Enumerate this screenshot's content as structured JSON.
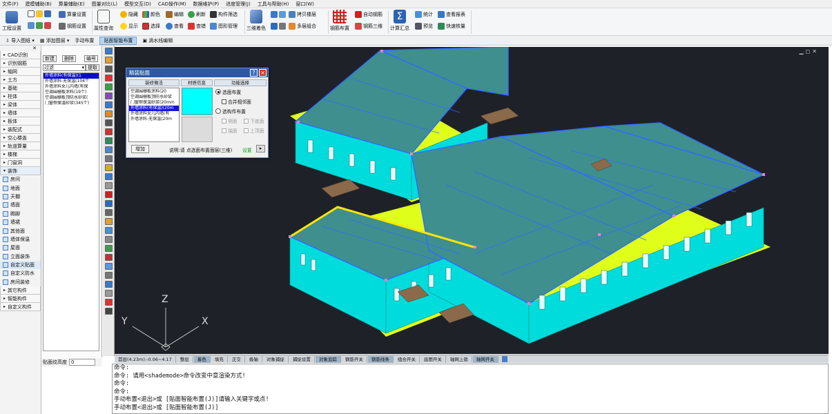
{
  "menu": [
    "文件(F)",
    "建模辅助(B)",
    "算量辅助(E)",
    "图量对比(L)",
    "模型交互(D)",
    "CAD操作(M)",
    "数据维护(P)",
    "进度管理(J)",
    "工具与帮助(H)",
    "窗口(W)"
  ],
  "ribbon": {
    "project_settings": "工程设置",
    "calc_settings": "算量设置",
    "rebar_settings": "钢筋设置",
    "property_query": "属性查询",
    "hide": "隐藏",
    "show": "显示",
    "color": "颜色",
    "select": "选择",
    "edit": "编辑",
    "view": "查看",
    "refresh": "刷新",
    "check": "查错",
    "component_filter": "构件筛选",
    "graphic_manage": "图形管理",
    "color3d": "三维着色",
    "copy_floor": "拷贝楼层",
    "multi_combine": "多层组合",
    "rebar_layout": "钢筋布置",
    "auto_rebar": "自动钢筋",
    "rebar3d": "钢筋三维",
    "calc_summary": "计算汇总",
    "stats": "统计",
    "preview": "预览",
    "view_report": "查看报表",
    "quick_check": "快速核量"
  },
  "subbar": {
    "import_drawing": "导入图纸",
    "add_layer": "添加图层",
    "manual_layout": "手动布置",
    "smart_layout": "贴面智能布置",
    "drip_edit": "滴水线编辑"
  },
  "categories_top": [
    "CAD识别",
    "识别钢筋",
    "轴网",
    "土方",
    "基础",
    "柱体",
    "梁体",
    "墙体",
    "板体",
    "装配式",
    "空心楼盖",
    "轨道算量",
    "楼梯",
    "门窗洞",
    "装饰"
  ],
  "decor_items": [
    "房间",
    "地面",
    "天棚",
    "墙面",
    "踢脚",
    "墙裙",
    "其他面",
    "墙体保温",
    "屋面",
    "立面装饰",
    "自定义贴面",
    "自定义防水",
    "房间装修"
  ],
  "categories_bottom": [
    "其它构件",
    "智能构件",
    "自定义构件"
  ],
  "list_panel": {
    "new_btn": "新建",
    "delete_btn": "删除",
    "copy_btn": "编号",
    "filter_label": "过滤",
    "extract_btn": "提取",
    "items": [
      "外墙涂料(有保温)(1",
      "外墙涂料-无保温(104个",
      "外墙涂料女儿内墙(有保",
      "空调围栅板涂料(19个)",
      "空调围栅板顶防水砂浆(",
      "门窗侧保温砂浆(345个)"
    ],
    "selected_index": 0,
    "bottom_label": "贴面纹高度",
    "bottom_value": "0"
  },
  "dialog": {
    "title": "精装贴面",
    "help": "?",
    "close": "×",
    "col1": "装修做法",
    "col2": "材质信息",
    "col3": "功能选择",
    "items": [
      "空调围栅板涂料(20",
      "空调围栅板顶防水砂浆",
      "门窗侧保温砂浆(20mm",
      "外墙涂料(有保温)(20m",
      "外墙涂料女儿内墙(有",
      "外墙涂料-无保温(20m"
    ],
    "selected_index": 3,
    "opt_face": "选面布置",
    "opt_merge": "合并相邻面",
    "opt_component": "选构件布置",
    "opt_side": "侧面",
    "opt_bottom": "下底面",
    "opt_end": "端面",
    "opt_top": "上顶面",
    "add_btn": "增加",
    "hint": "说明:请 点选面布置面层(三维)",
    "settings_link": "设置",
    "swatch_color": "#00ffff"
  },
  "axes": {
    "z": "Z",
    "y": "Y",
    "x": "X"
  },
  "status": [
    "首层(4.23m):-0.06~4.17",
    "整层",
    "着色",
    "填充",
    "正交",
    "极轴",
    "对象捕捉",
    "捕捉设置",
    "对象追踪",
    "钢筋开关",
    "钢筋线条",
    "组合开关",
    "底图开关",
    "轴网上锁",
    "轴网开关"
  ],
  "status_on": [
    2,
    8,
    10,
    14
  ],
  "console": [
    "命令:",
    "命令: 请用<shademode>命令改变中意渲染方式!",
    "命令:",
    "命令:",
    "手动布置<退出>或 [贴面智能布置(J)]请输入关键字或点!",
    "手动布置<退出>或 [贴面智能布置(J)]"
  ],
  "colors": {
    "roof": "#3f8f8f",
    "wall": "#00e3e3",
    "ground": "#dfff1a",
    "blue_edge": "#2f6bff",
    "viewport_bg": "#1f2128"
  }
}
